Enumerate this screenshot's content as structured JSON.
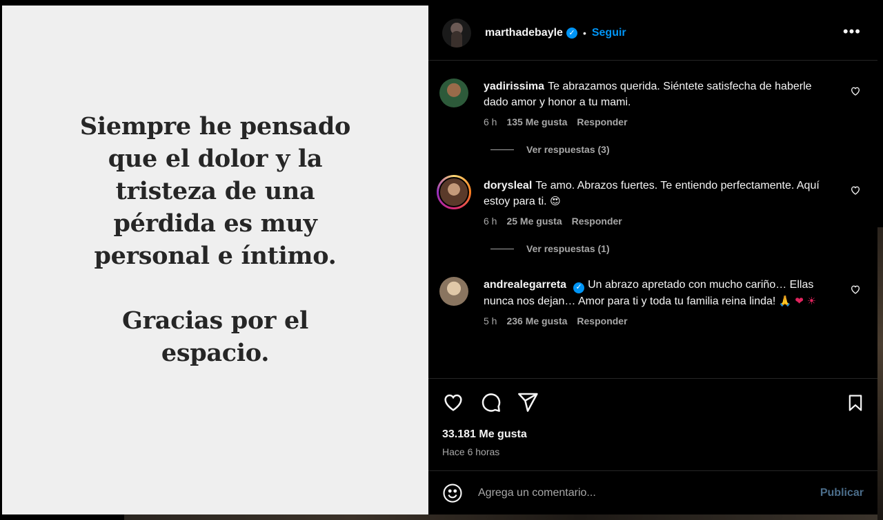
{
  "post": {
    "image_text": [
      "Siempre he pensado\nque el dolor y la\ntristeza de una\npérdida es muy\npersonal e íntimo.",
      "Gracias por el\nespacio."
    ]
  },
  "header": {
    "username": "marthadebayle",
    "verified": true,
    "separator": "•",
    "follow_label": "Seguir",
    "more_icon": "more-horizontal-icon"
  },
  "comments": [
    {
      "username": "yadirissima",
      "verified": false,
      "text": "Te abrazamos querida. Siéntete satisfecha de haberle dado amor y honor a tu mami.",
      "time": "6 h",
      "likes": "135 Me gusta",
      "reply": "Responder",
      "replies_label": "Ver respuestas (3)"
    },
    {
      "username": "dorysleal",
      "verified": false,
      "text": "Te amo. Abrazos fuertes. Te entiendo perfectamente. Aquí estoy para ti.",
      "emoji": "😍",
      "time": "6 h",
      "likes": "25 Me gusta",
      "reply": "Responder",
      "replies_label": "Ver respuestas (1)"
    },
    {
      "username": "andrealegarreta",
      "verified": true,
      "text": "Un abrazo apretado con mucho cariño… Ellas nunca nos dejan… Amor para ti y toda tu familia reina linda!",
      "emoji": "🙏 ❤ ☀",
      "time": "5 h",
      "likes": "236 Me gusta",
      "reply": "Responder"
    }
  ],
  "actions": {
    "likes_total": "33.181 Me gusta",
    "time_ago": "Hace 6 horas"
  },
  "composer": {
    "placeholder": "Agrega un comentario...",
    "publish_label": "Publicar"
  },
  "colors": {
    "background": "#000000",
    "accent": "#0095f6",
    "muted_text": "#a8a8a8",
    "post_background": "#efefef"
  }
}
